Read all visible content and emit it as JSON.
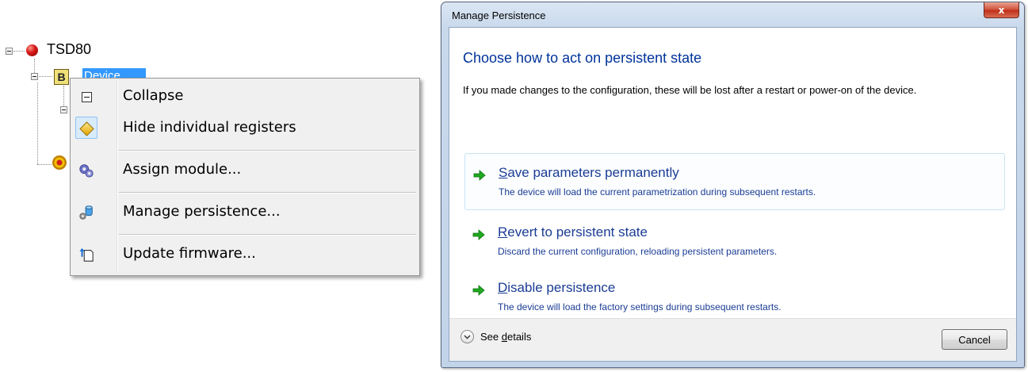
{
  "tree": {
    "root_label": "TSD80",
    "device_label": "Device",
    "device_icon_letter": "B"
  },
  "context_menu": {
    "items": [
      {
        "label": "Collapse",
        "icon": "collapse-icon"
      },
      {
        "label": "Hide individual registers",
        "icon": "diamond-register-icon",
        "checked": true
      },
      {
        "label": "Assign module...",
        "icon": "gears-icon"
      },
      {
        "label": "Manage persistence...",
        "icon": "database-gear-icon"
      },
      {
        "label": "Update firmware...",
        "icon": "firmware-upload-icon"
      }
    ]
  },
  "dialog": {
    "title": "Manage Persistence",
    "close_label": "x",
    "heading": "Choose how to act on persistent state",
    "description": "If you made changes to the configuration, these will be lost after a restart or power-on of the device.",
    "commands": [
      {
        "accel": "S",
        "title_rest": "ave parameters permanently",
        "subtitle": "The device will load the current parametrization during subsequent restarts."
      },
      {
        "accel": "R",
        "title_rest": "evert to persistent state",
        "subtitle": "Discard the current configuration, reloading persistent parameters."
      },
      {
        "accel": "D",
        "title_rest": "isable persistence",
        "subtitle": "The device will load the factory settings during subsequent restarts."
      }
    ],
    "details_prefix": "See ",
    "details_accel": "d",
    "details_rest": "etails",
    "cancel_label": "Cancel"
  },
  "colors": {
    "heading": "#003399",
    "command_text": "#1a3c94",
    "selection": "#3399ff",
    "arrow_green": "#1faa1f"
  }
}
